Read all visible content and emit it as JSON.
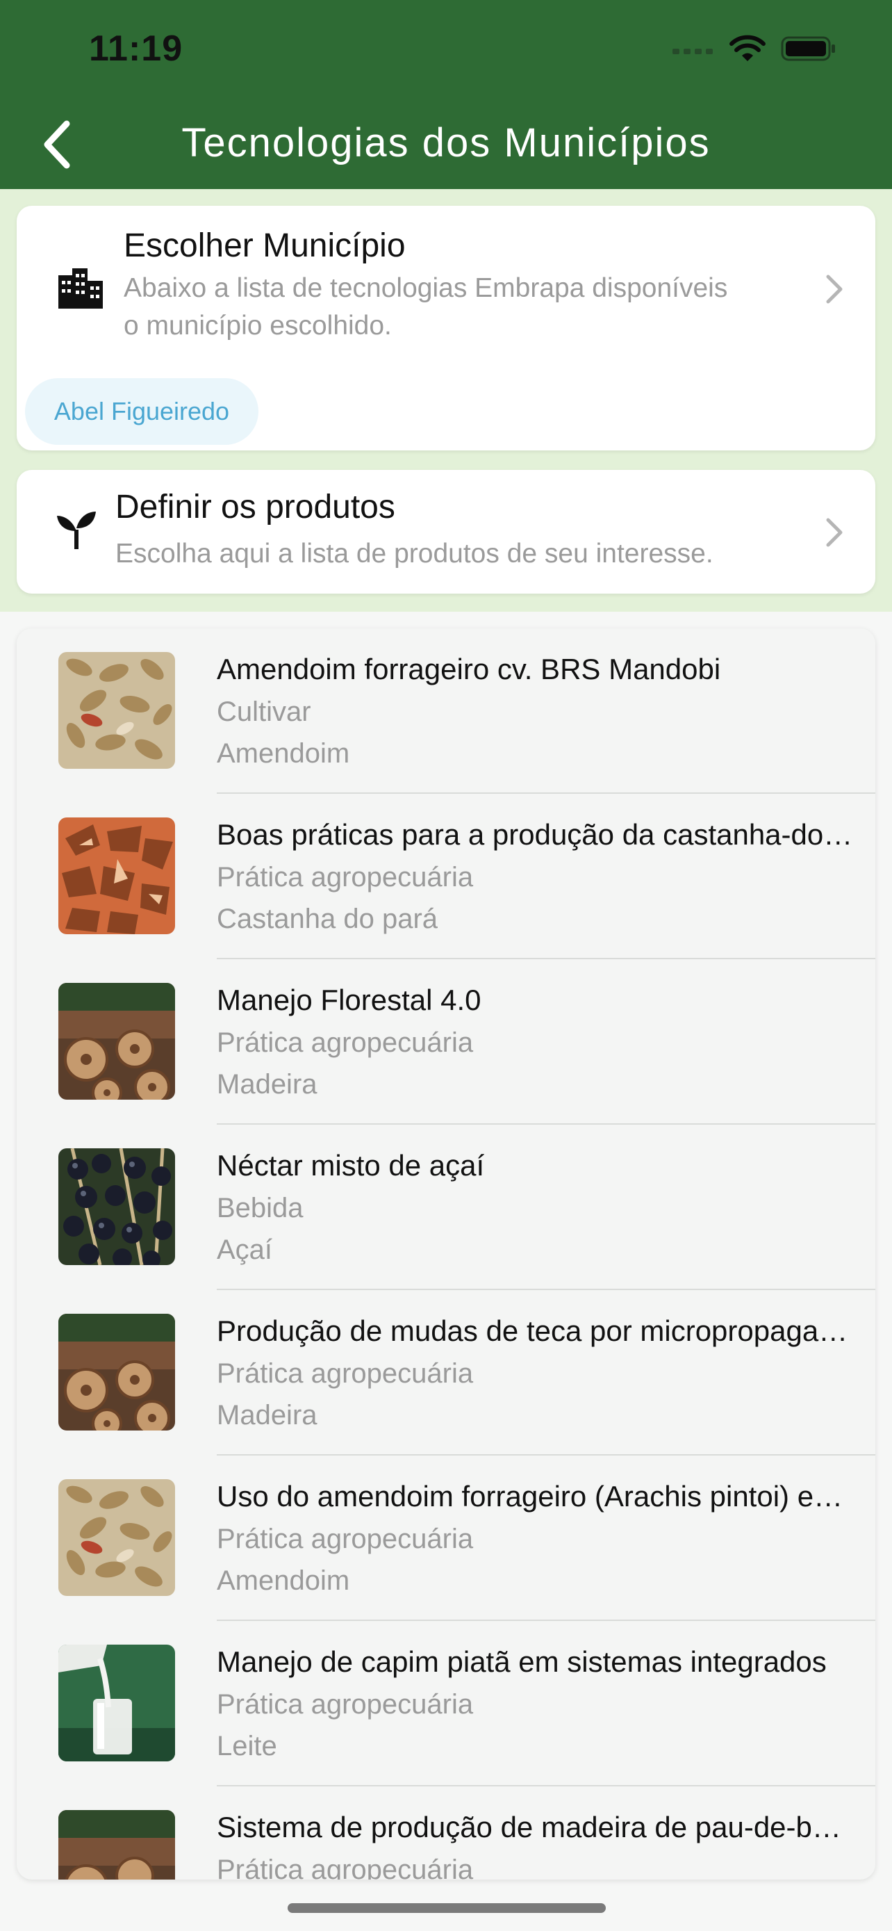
{
  "status": {
    "time": "11:19"
  },
  "nav": {
    "title": "Tecnologias dos Municípios"
  },
  "municipio_card": {
    "title": "Escolher Município",
    "subtitle_line1": "Abaixo a lista de tecnologias Embrapa disponíveis",
    "subtitle_line2": "o município escolhido.",
    "chip": "Abel Figueiredo"
  },
  "produtos_card": {
    "title": "Definir os produtos",
    "subtitle": "Escolha aqui a lista de produtos de seu interesse."
  },
  "items": [
    {
      "title": "Amendoim forrageiro cv. BRS Mandobi",
      "type": "Cultivar",
      "product": "Amendoim",
      "image": "peanuts-image"
    },
    {
      "title": "Boas práticas para a produção da castanha-do-brasil",
      "type": "Prática agropecuária",
      "product": "Castanha do pará",
      "image": "brazil-nuts-image"
    },
    {
      "title": "Manejo Florestal 4.0",
      "type": "Prática agropecuária",
      "product": "Madeira",
      "image": "logs-image"
    },
    {
      "title": "Néctar misto de açaí",
      "type": "Bebida",
      "product": "Açaí",
      "image": "acai-berries-image"
    },
    {
      "title": "Produção de mudas de teca por micropropagação",
      "type": "Prática agropecuária",
      "product": "Madeira",
      "image": "logs-image"
    },
    {
      "title": "Uso do amendoim forrageiro (Arachis pintoi) em pastagens",
      "type": "Prática agropecuária",
      "product": "Amendoim",
      "image": "peanuts-image"
    },
    {
      "title": "Manejo de capim piatã em sistemas integrados",
      "type": "Prática agropecuária",
      "product": "Leite",
      "image": "milk-glass-image"
    },
    {
      "title": "Sistema de produção de madeira de pau-de-balsa",
      "type": "Prática agropecuária",
      "product": "",
      "image": "logs-image"
    }
  ],
  "colors": {
    "header": "#2e6b34",
    "top_area": "#e3f1d8",
    "chip_bg": "#eaf6fb",
    "chip_text": "#4aa6d1"
  }
}
